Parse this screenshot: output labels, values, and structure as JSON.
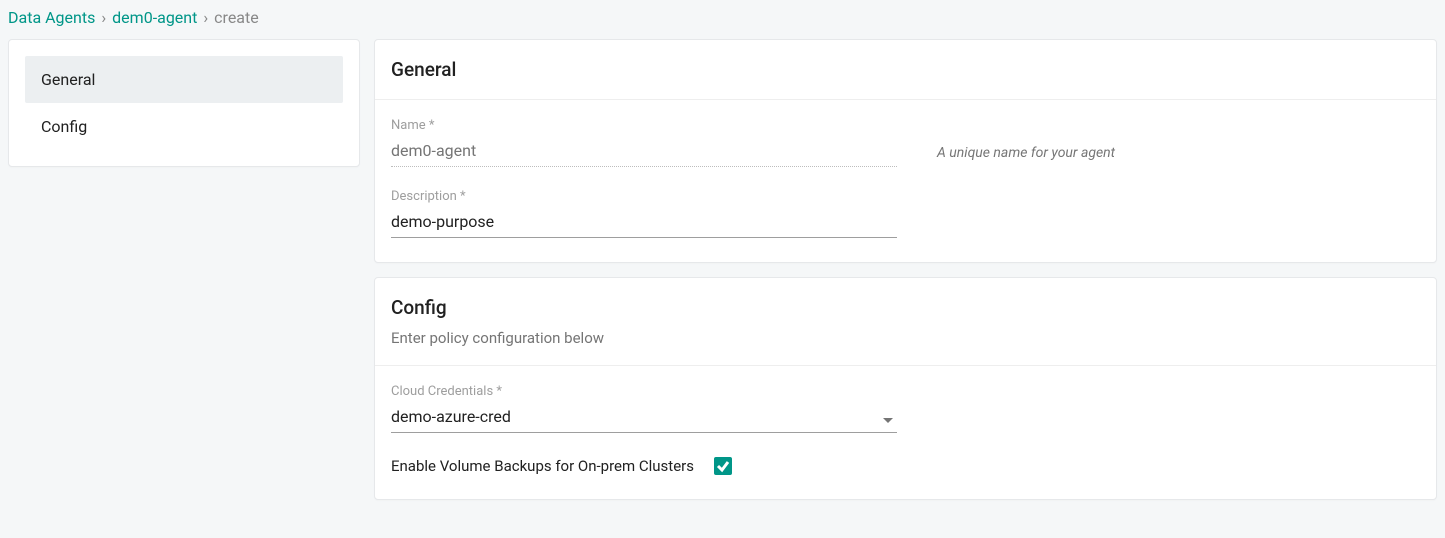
{
  "breadcrumb": {
    "items": [
      {
        "label": "Data Agents"
      },
      {
        "label": "dem0-agent"
      }
    ],
    "current": "create"
  },
  "sidebar": {
    "items": [
      {
        "label": "General",
        "active": true
      },
      {
        "label": "Config",
        "active": false
      }
    ]
  },
  "general": {
    "title": "General",
    "name_label": "Name *",
    "name_value": "dem0-agent",
    "name_help": "A unique name for your agent",
    "description_label": "Description *",
    "description_value": "demo-purpose"
  },
  "config": {
    "title": "Config",
    "subtitle": "Enter policy configuration below",
    "cloud_cred_label": "Cloud Credentials *",
    "cloud_cred_value": "demo-azure-cred",
    "enable_backups_label": "Enable Volume Backups for On-prem Clusters",
    "enable_backups_checked": true
  },
  "colors": {
    "accent": "#009688"
  }
}
